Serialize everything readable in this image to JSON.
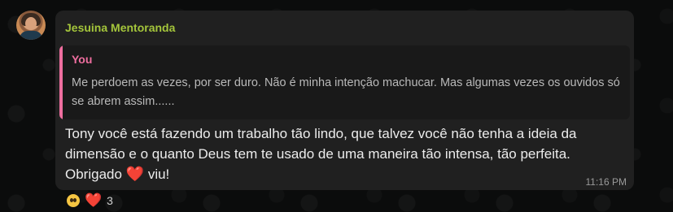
{
  "sender": {
    "name": "Jesuina Mentoranda"
  },
  "quote": {
    "author": "You",
    "text": "Me perdoem as vezes, por ser duro. Não é minha intenção machucar. Mas algumas vezes os ouvidos só se abrem assim......"
  },
  "message": {
    "part1": "Tony você está fazendo um trabalho tão lindo,  que talvez você não tenha a ideia da dimensão e o quanto Deus tem te usado de uma maneira tão intensa, tão perfeita. Obrigado ",
    "emoji": "❤️",
    "part2": " viu!",
    "time": "11:16 PM"
  },
  "reactions": {
    "emojis": [
      "pleading-face",
      "red-heart"
    ],
    "heart": "❤️",
    "count": "3"
  },
  "colors": {
    "sender": "#a4c53b",
    "quote_accent": "#ef6e9f",
    "bubble_bg": "#202020"
  }
}
